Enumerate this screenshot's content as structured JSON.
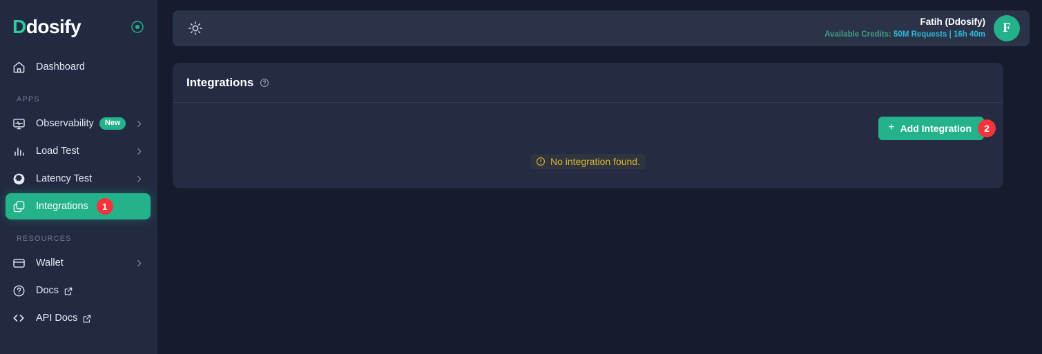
{
  "brand": {
    "logo_first": "D",
    "logo_rest": "dosify",
    "accent_color": "#24b28b",
    "danger_color": "#f8333c",
    "warning_color": "#d6b430",
    "sidebar_bg": "#222a41",
    "page_bg": "#161c2d",
    "card_bg": "#242b42",
    "topbar_bg": "#2b3349"
  },
  "sidebar": {
    "collapse_icon": "circle-dot-icon",
    "dashboard": {
      "label": "Dashboard",
      "icon": "home-icon"
    },
    "sections": [
      {
        "label": "APPS",
        "items": [
          {
            "label": "Observability",
            "icon": "monitor-pulse-icon",
            "badge": "New",
            "chevron": true
          },
          {
            "label": "Load Test",
            "icon": "bar-chart-icon",
            "chevron": true
          },
          {
            "label": "Latency Test",
            "icon": "globe-icon",
            "chevron": true
          },
          {
            "label": "Integrations",
            "icon": "integrations-icon",
            "active": true,
            "step_badge": "1"
          }
        ]
      },
      {
        "label": "RESOURCES",
        "items": [
          {
            "label": "Wallet",
            "icon": "card-icon",
            "chevron": true
          },
          {
            "label": "Docs",
            "icon": "question-circle-icon",
            "external": true
          },
          {
            "label": "API Docs",
            "icon": "code-brackets-icon",
            "external": true
          }
        ]
      }
    ]
  },
  "topbar": {
    "theme_toggle_icon": "sun-icon",
    "user_name": "Fatih (Ddosify)",
    "credits_label": "Available Credits:",
    "credits_value": "50M Requests | 16h 40m",
    "avatar_initial": "F"
  },
  "card": {
    "title": "Integrations",
    "help_icon": "question-circle-icon",
    "add_button_label": "Add Integration",
    "add_button_plus": "+",
    "add_button_badge": "2",
    "empty_message": "No integration found.",
    "empty_icon": "warning-circle-icon"
  }
}
